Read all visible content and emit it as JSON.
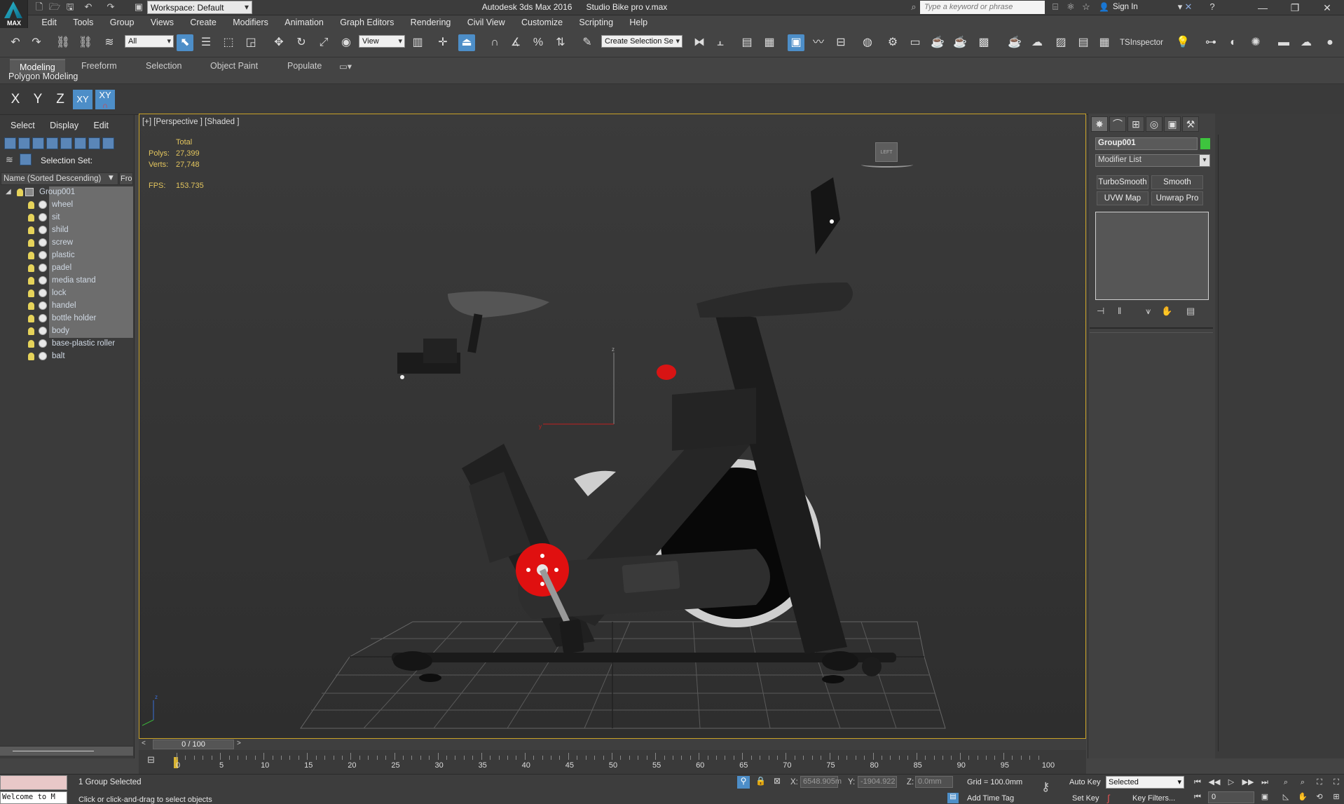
{
  "titlebar": {
    "workspace_label": "Workspace: Default",
    "title": "Autodesk 3ds Max 2016",
    "file_name": "Studio Bike pro v.max",
    "search_placeholder": "Type a keyword or phrase",
    "sign_in": "Sign In",
    "logo_text": "MAX"
  },
  "menubar": {
    "items": [
      "Edit",
      "Tools",
      "Group",
      "Views",
      "Create",
      "Modifiers",
      "Animation",
      "Graph Editors",
      "Rendering",
      "Civil View",
      "Customize",
      "Scripting",
      "Help"
    ]
  },
  "toolbar": {
    "selection_filter": "All",
    "ref_coord": "View",
    "named_selection": "Create Selection Se",
    "ts_inspector": "TSInspector"
  },
  "ribbon": {
    "tabs": [
      "Modeling",
      "Freeform",
      "Selection",
      "Object Paint",
      "Populate"
    ],
    "active_tab": "Modeling",
    "panel_label": "Polygon Modeling"
  },
  "axis_constraints": {
    "x": "X",
    "y": "Y",
    "z": "Z",
    "xy": "XY",
    "xy_snap": "XY"
  },
  "explorer": {
    "menus": [
      "Select",
      "Display",
      "Edit"
    ],
    "selection_set_label": "Selection Set:",
    "column_name": "Name (Sorted Descending)",
    "column_frozen": "Fro",
    "group_name": "Group001",
    "children": [
      "wheel",
      "sit",
      "shild",
      "screw",
      "plastic",
      "padel",
      "media stand",
      "lock",
      "handel",
      "bottle holder",
      "body",
      "base-plastic roller",
      "balt"
    ]
  },
  "viewport": {
    "label": "[+] [Perspective ] [Shaded ]",
    "stats_total": "Total",
    "polys_label": "Polys:",
    "polys_value": "27,399",
    "verts_label": "Verts:",
    "verts_value": "27,748",
    "fps_label": "FPS:",
    "fps_value": "153.735",
    "viewcube_label": "LEFT"
  },
  "command_panel": {
    "object_name": "Group001",
    "object_color": "#3ec43e",
    "modifier_list": "Modifier List",
    "buttons": [
      "TurboSmooth",
      "Smooth",
      "UVW Map",
      "Unwrap Pro"
    ]
  },
  "timeline": {
    "frame_display": "0 / 100",
    "ticks": [
      "0",
      "5",
      "10",
      "15",
      "20",
      "25",
      "30",
      "35",
      "40",
      "45",
      "50",
      "55",
      "60",
      "65",
      "70",
      "75",
      "80",
      "85",
      "90",
      "95",
      "100"
    ]
  },
  "statusbar": {
    "listener": "Welcome to M",
    "selected": "1 Group Selected",
    "prompt": "Click or click-and-drag to select objects",
    "x_label": "X:",
    "x_value": "6548.905m",
    "y_label": "Y:",
    "y_value": "-1904.922",
    "z_label": "Z:",
    "z_value": "0.0mm",
    "grid": "Grid = 100.0mm",
    "add_time_tag": "Add Time Tag",
    "auto_key": "Auto Key",
    "set_key": "Set Key",
    "key_mode": "Selected",
    "key_filters": "Key Filters...",
    "frame_field": "0"
  },
  "colors": {
    "accent": "#4d8ec8",
    "viewport_border": "#c9a227",
    "stats_text": "#e3c55e",
    "bike_red": "#e01010"
  }
}
